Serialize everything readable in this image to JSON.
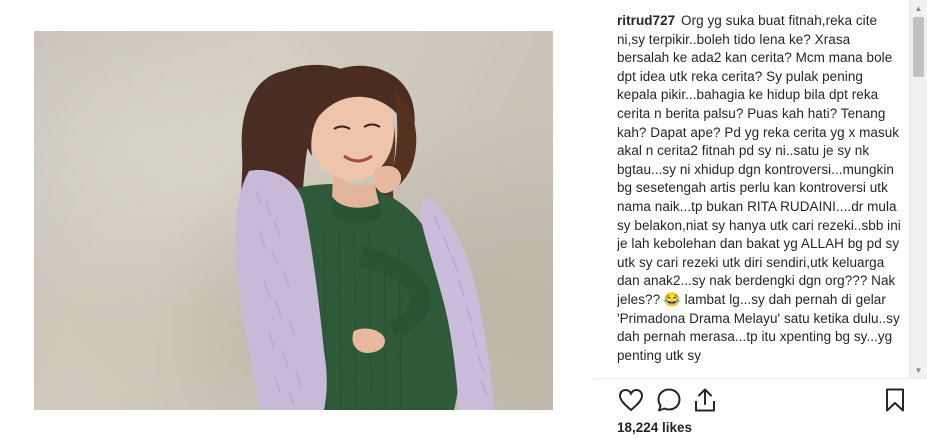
{
  "post": {
    "username": "ritrud727",
    "caption": "Org yg suka buat fitnah,reka cite ni,sy terpikir..boleh tido lena ke? Xrasa bersalah ke ada2 kan cerita? Mcm mana bole dpt idea utk reka cerita? Sy pulak pening kepala pikir...bahagia ke hidup bila dpt reka cerita n berita palsu? Puas kah hati? Tenang kah? Dapat ape? Pd yg reka cerita yg x masuk akal n cerita2 fitnah pd sy ni..satu je sy nk bgtau...sy ni xhidup dgn kontroversi...mungkin bg sesetengah artis perlu kan kontroversi utk nama naik...tp bukan RITA RUDAINI....dr mula sy belakon,niat sy hanya utk cari rezeki..sbb ini je lah kebolehan dan bakat yg ALLAH bg pd sy utk sy cari rezeki utk diri sendiri,utk keluarga dan anak2...sy nak berdengki dgn org??? Nak jeles?? 😂 lambat lg...sy dah pernah di gelar 'Primadona Drama Melayu' satu ketika dulu..sy dah pernah merasa...tp itu xpenting bg sy...yg penting utk sy",
    "likes": "18,224 likes"
  },
  "actions": {
    "like_icon": "heart-icon",
    "comment_icon": "comment-bubble-icon",
    "share_icon": "share-icon",
    "save_icon": "bookmark-icon"
  },
  "colors": {
    "text": "#262626",
    "divider": "#efefef",
    "dress": "#2f5a3a",
    "cardigan": "#c9b9d9"
  }
}
